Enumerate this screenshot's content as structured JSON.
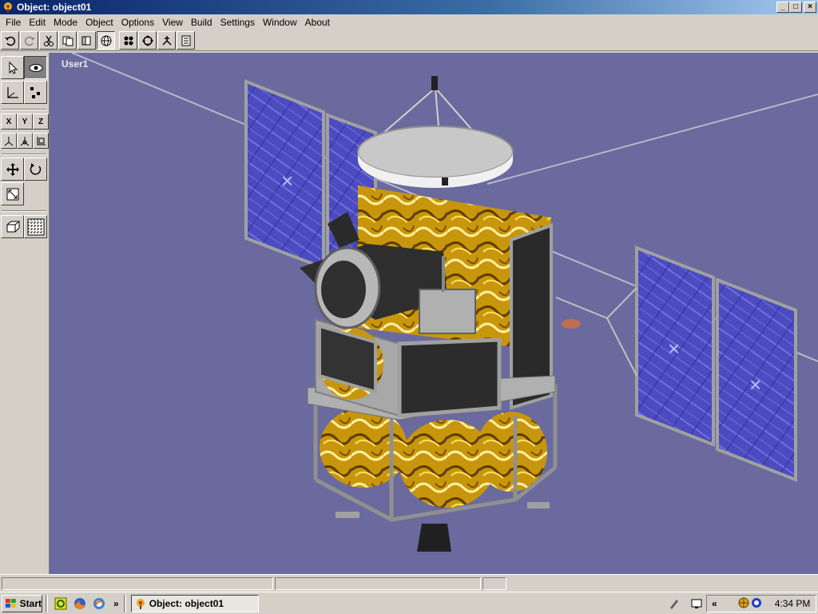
{
  "window": {
    "title": "Object: object01",
    "buttons": {
      "minimize": "_",
      "maximize": "□",
      "close": "×"
    }
  },
  "menu": [
    {
      "label": "File"
    },
    {
      "label": "Edit"
    },
    {
      "label": "Mode"
    },
    {
      "label": "Object"
    },
    {
      "label": "Options"
    },
    {
      "label": "View"
    },
    {
      "label": "Build"
    },
    {
      "label": "Settings"
    },
    {
      "label": "Window"
    },
    {
      "label": "About"
    }
  ],
  "viewport": {
    "label": "User1",
    "background": "#6a6a9e"
  },
  "tools": {
    "axis_x": "X",
    "axis_y": "Y",
    "axis_z": "Z"
  },
  "taskbar": {
    "start_label": "Start",
    "overflow": "»",
    "task_title": "Object: object01",
    "tray_chevron": "«",
    "clock": "4:34 PM"
  },
  "colors": {
    "title_start": "#0a246a",
    "title_end": "#a6caf0",
    "panel": "#d4d0c8",
    "gold": "#d4a017",
    "solar": "#4a4ab8"
  }
}
